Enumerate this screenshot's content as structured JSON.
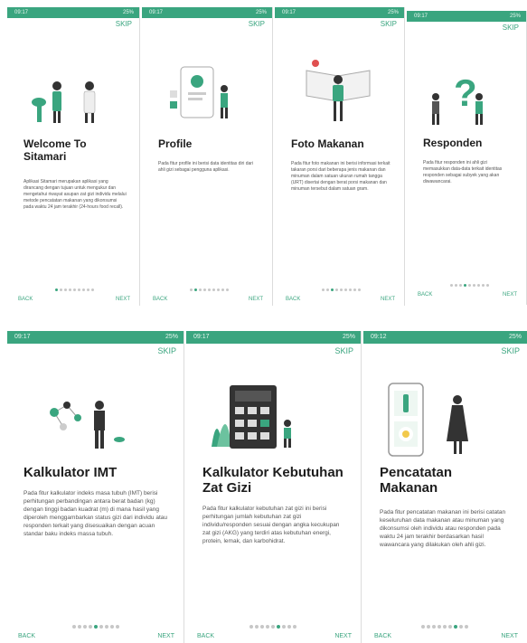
{
  "colors": {
    "accent": "#3aa57f",
    "status_bar": "#3aa57f"
  },
  "screens": [
    {
      "status_time": "09:17",
      "status_right": "25%",
      "skip": "SKIP",
      "title": "Welcome To Sitamari",
      "desc": "Aplikasi Sitamari merupakan aplikasi yang dirancang dengan tujuan untuk mengukur dan mengetahui riwayat asupan zat gizi individu melalui metode pencatatan makanan yang dikonsumsi pada waktu 24 jam terakhir (24-hours food recall).",
      "back": "BACK",
      "next": "NEXT",
      "illustration_icon": "doctors-icon",
      "dots": 9,
      "active_dot": 0
    },
    {
      "status_time": "09:17",
      "status_right": "25%",
      "skip": "SKIP",
      "title": "Profile",
      "desc": "Pada fitur profile ini berisi data identitas diri dari ahli gizi sebagai pengguna aplikasi.",
      "back": "BACK",
      "next": "NEXT",
      "illustration_icon": "profile-card-icon",
      "dots": 9,
      "active_dot": 1
    },
    {
      "status_time": "09:17",
      "status_right": "25%",
      "skip": "SKIP",
      "title": "Foto Makanan",
      "desc": "Pada fitur foto makanan ini berisi informasi terkait takaran porsi dari beberapa jenis makanan dan minuman dalam satuan ukuran rumah tangga (URT) disertai dengan berat porsi makanan dan minuman tersebut dalam satuan gram.",
      "back": "BACK",
      "next": "NEXT",
      "illustration_icon": "book-reader-icon",
      "dots": 9,
      "active_dot": 2
    },
    {
      "status_time": "09:17",
      "status_right": "25%",
      "skip": "SKIP",
      "title": "Responden",
      "desc": "Pada fitur responden ini ahli gizi memasukkan data-data terkait identitas responden sebagai subyek yang akan diwawancarai.",
      "back": "BACK",
      "next": "NEXT",
      "illustration_icon": "question-mark-icon",
      "dots": 9,
      "active_dot": 3
    },
    {
      "status_time": "09:17",
      "status_right": "25%",
      "skip": "SKIP",
      "title": "Kalkulator IMT",
      "desc": "Pada fitur kalkulator indeks masa tubuh (IMT) berisi perhitungan perbandingan antara berat badan (kg) dengan tinggi badan kuadrat (m) di mana hasil yang diperoleh menggambarkan status gizi dari individu atau responden terkait yang disesuaikan dengan acuan standar baku indeks massa tubuh.",
      "back": "BACK",
      "next": "NEXT",
      "illustration_icon": "molecule-person-icon",
      "dots": 9,
      "active_dot": 4
    },
    {
      "status_time": "09:17",
      "status_right": "25%",
      "skip": "SKIP",
      "title": "Kalkulator Kebutuhan Zat Gizi",
      "desc": "Pada fitur kalkulator kebutuhan zat gizi ini berisi perhitungan jumlah kebutuhan zat gizi individu/responden sesuai dengan angka kecukupan zat gizi (AKG) yang terdiri atas kebutuhan energi, protein, lemak, dan karbohidrat.",
      "back": "BACK",
      "next": "NEXT",
      "illustration_icon": "calculator-icon",
      "dots": 9,
      "active_dot": 5
    },
    {
      "status_time": "09:12",
      "status_right": "25%",
      "skip": "SKIP",
      "title": "Pencatatan Makanan",
      "desc": "Pada fitur pencatatan makanan ini berisi catatan keseluruhan data makanan atau minuman yang dikonsumsi oleh individu atau responden pada waktu 24 jam terakhir berdasarkan hasil wawancara yang dilakukan oleh ahli gizi.",
      "back": "BACK",
      "next": "NEXT",
      "illustration_icon": "phone-food-icon",
      "dots": 9,
      "active_dot": 6
    }
  ]
}
